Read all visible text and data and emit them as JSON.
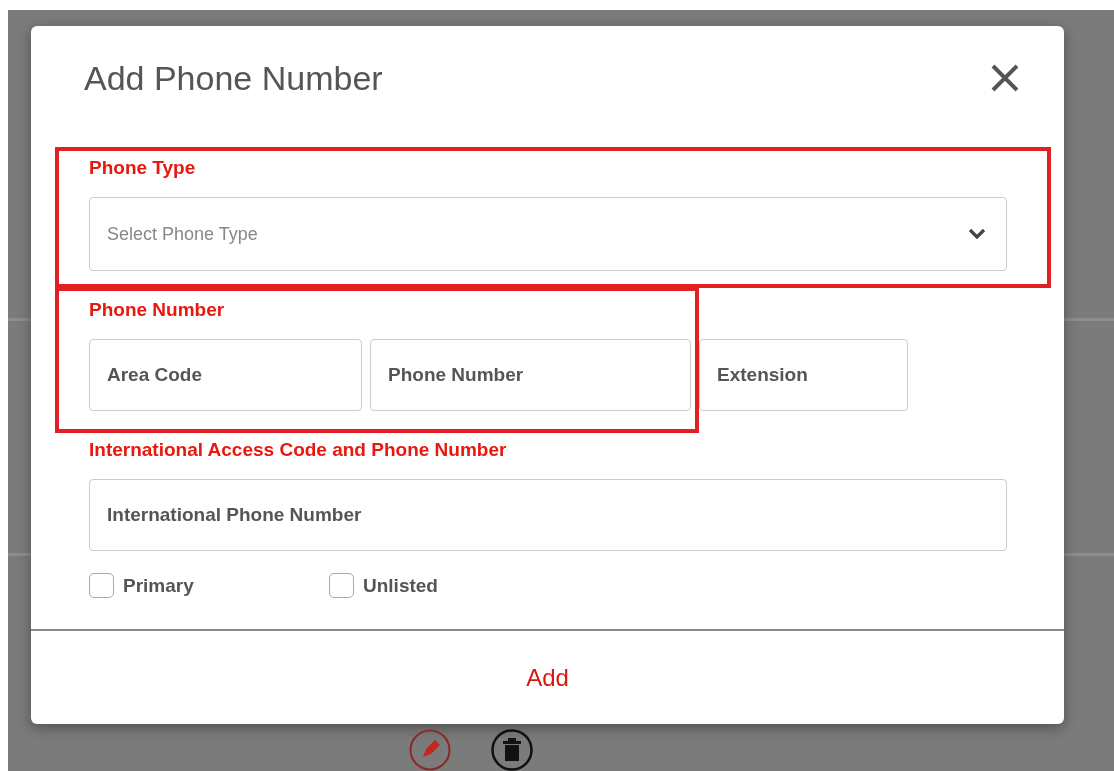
{
  "dialog": {
    "title": "Add Phone Number"
  },
  "phone_type": {
    "label": "Phone Type",
    "placeholder": "Select Phone Type",
    "highlighted": true
  },
  "phone_number": {
    "label": "Phone Number",
    "highlighted": true,
    "highlighted_fields": [
      {
        "placeholder": "Area Code"
      },
      {
        "placeholder": "Phone Number"
      }
    ],
    "other_fields": [
      {
        "placeholder": "Extension"
      }
    ]
  },
  "international": {
    "label": "International Access Code and Phone Number",
    "placeholder": "International Phone Number"
  },
  "options": [
    {
      "label": "Primary",
      "checked": false
    },
    {
      "label": "Unlisted",
      "checked": false
    }
  ],
  "footer_button": "Add"
}
